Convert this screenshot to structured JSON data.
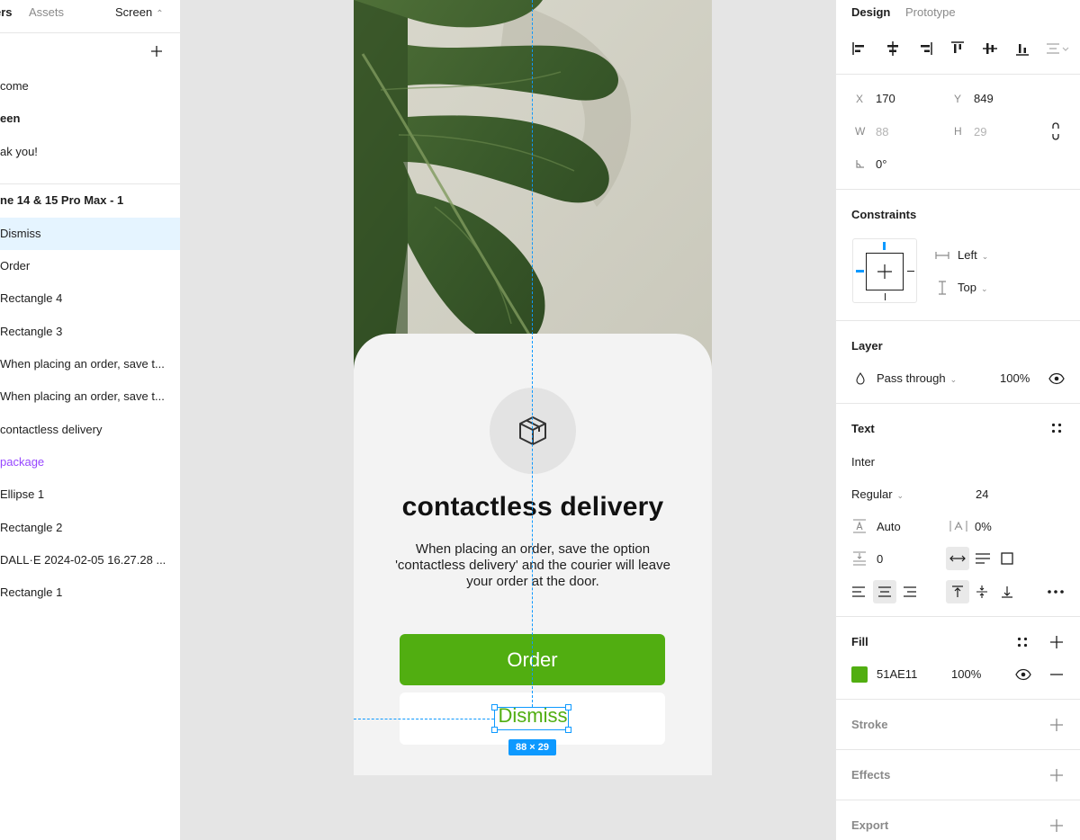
{
  "left_panel": {
    "tabs": {
      "layers": "ers",
      "assets": "Assets"
    },
    "page_select": "Screen",
    "pages": [
      "come",
      "een",
      "ak you!"
    ],
    "frame_name": "ne 14 & 15 Pro Max - 1",
    "layers": [
      "Dismiss",
      "Order",
      "Rectangle 4",
      "Rectangle 3",
      "When placing an order, save t...",
      "When placing an order, save t...",
      "contactless delivery",
      "package",
      "Ellipse 1",
      "Rectangle 2",
      "DALL·E 2024-02-05 16.27.28 ...",
      "Rectangle 1"
    ]
  },
  "canvas": {
    "card_title": "contactless delivery",
    "card_body": "When placing an order, save the option 'contactless delivery' and the courier will leave your order at the door.",
    "order_button": "Order",
    "dismiss_button": "Dismiss",
    "selection_size": "88 × 29"
  },
  "right_panel": {
    "tabs": {
      "design": "Design",
      "prototype": "Prototype"
    },
    "x_label": "X",
    "x_value": "170",
    "y_label": "Y",
    "y_value": "849",
    "w_label": "W",
    "w_value": "88",
    "h_label": "H",
    "h_value": "29",
    "rotation": "0°",
    "constraints_title": "Constraints",
    "constraint_h": "Left",
    "constraint_v": "Top",
    "layer_title": "Layer",
    "blend_mode": "Pass through",
    "layer_opacity": "100%",
    "text_title": "Text",
    "font_family": "Inter",
    "font_weight": "Regular",
    "font_size": "24",
    "line_height": "Auto",
    "letter_spacing": "0%",
    "paragraph_spacing": "0",
    "fill_title": "Fill",
    "fill_hex": "51AE11",
    "fill_opacity": "100%",
    "stroke_title": "Stroke",
    "effects_title": "Effects",
    "export_title": "Export"
  },
  "colors": {
    "accent": "#0d99ff",
    "brand_green": "#51ae11",
    "component": "#9747ff",
    "selected_row": "#e5f4ff"
  }
}
